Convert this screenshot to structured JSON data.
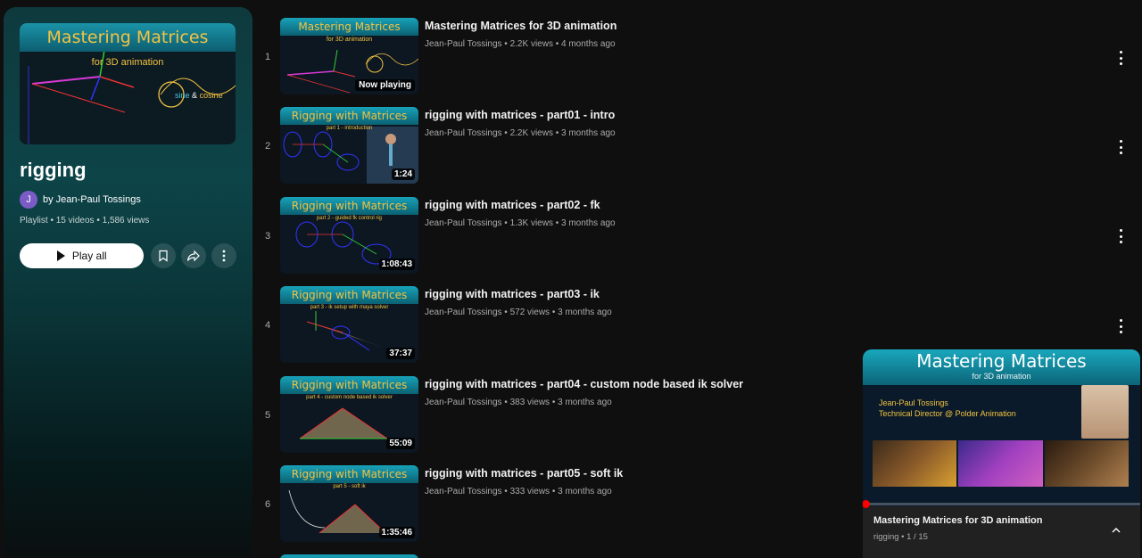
{
  "playlist": {
    "thumb_title": "Mastering Matrices",
    "thumb_subtitle": "for 3D animation",
    "thumb_labels": [
      "sine",
      "&",
      "cosine"
    ],
    "title": "rigging",
    "avatar_letter": "J",
    "owner": "by Jean-Paul Tossings",
    "stats": "Playlist • 15 videos • 1,586 views",
    "play_all_label": "Play all"
  },
  "videos": [
    {
      "index": "1",
      "thumb_title": "Mastering Matrices",
      "thumb_sub": "for 3D animation",
      "badge": "Now playing",
      "title": "Mastering Matrices for 3D animation",
      "meta": "Jean-Paul Tossings • 2.2K views • 4 months ago"
    },
    {
      "index": "2",
      "thumb_title": "Rigging with Matrices",
      "thumb_sub": "part 1 - introduction",
      "badge": "1:24",
      "title": "rigging with matrices - part01 - intro",
      "meta": "Jean-Paul Tossings • 2.2K views • 3 months ago"
    },
    {
      "index": "3",
      "thumb_title": "Rigging with Matrices",
      "thumb_sub": "part 2 - guided fk control rig",
      "badge": "1:08:43",
      "title": "rigging with matrices - part02 - fk",
      "meta": "Jean-Paul Tossings • 1.3K views • 3 months ago"
    },
    {
      "index": "4",
      "thumb_title": "Rigging with Matrices",
      "thumb_sub": "part 3 - ik setup with maya solver",
      "badge": "37:37",
      "title": "rigging with matrices - part03 - ik",
      "meta": "Jean-Paul Tossings • 572 views • 3 months ago"
    },
    {
      "index": "5",
      "thumb_title": "Rigging with Matrices",
      "thumb_sub": "part 4 - custom node based ik solver",
      "badge": "55:09",
      "title": "rigging with matrices - part04 - custom node based ik solver",
      "meta": "Jean-Paul Tossings • 383 views • 3 months ago"
    },
    {
      "index": "6",
      "thumb_title": "Rigging with Matrices",
      "thumb_sub": "part 5 - soft ik",
      "badge": "1:35:46",
      "title": "rigging with matrices - part05 - soft ik",
      "meta": "Jean-Paul Tossings • 333 views • 3 months ago"
    }
  ],
  "mini_player": {
    "banner_title": "Mastering Matrices",
    "banner_sub": "for 3D animation",
    "presenter_name": "Jean-Paul Tossings",
    "presenter_role": "Technical Director @ Polder Animation",
    "title": "Mastering Matrices for 3D animation",
    "subtitle": "rigging • 1 / 15",
    "progress": 0.0
  },
  "icons": [
    "play-icon",
    "save-icon",
    "share-icon",
    "more-icon",
    "kebab-icon",
    "chevron-up-icon"
  ],
  "colors": {
    "accent": "#f3c341",
    "banner": "#1893a8",
    "progress": "#ff0000"
  }
}
